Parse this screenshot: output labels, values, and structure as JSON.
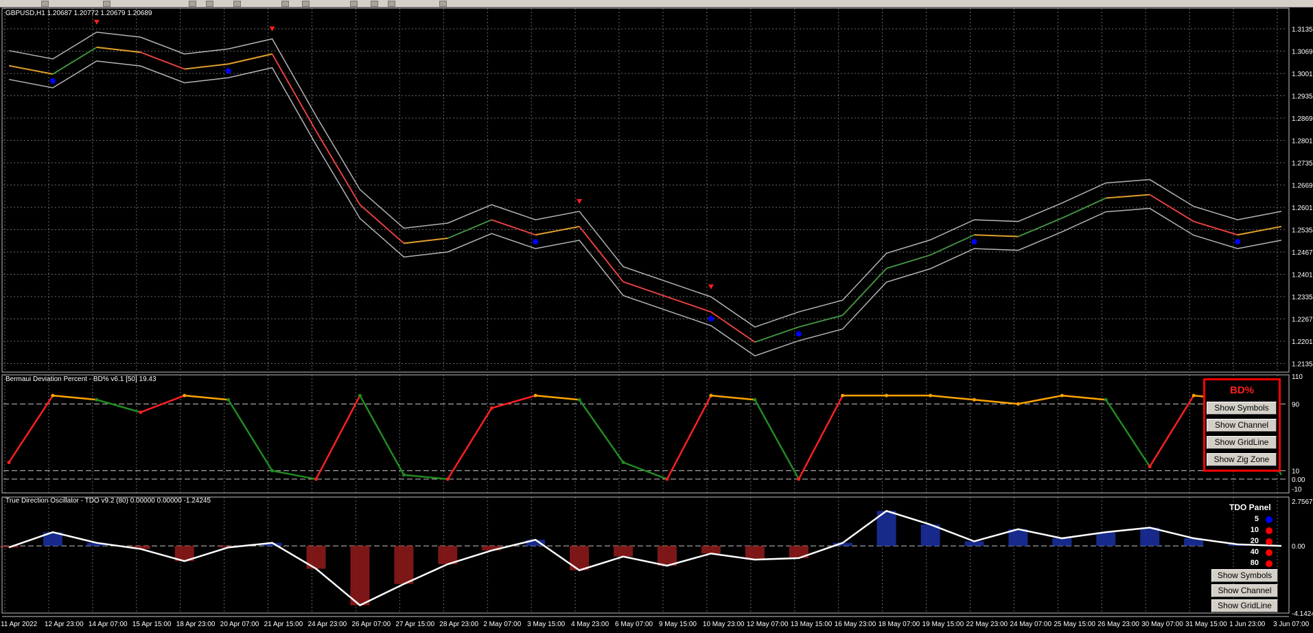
{
  "main_chart": {
    "title": "GBPUSD,H1  1.20687 1.20772 1.20679 1.20689",
    "price_ticks": [
      "1.31350",
      "1.30690",
      "1.30010",
      "1.29350",
      "1.28690",
      "1.28010",
      "1.27350",
      "1.26690",
      "1.26010",
      "1.25350",
      "1.24670",
      "1.24010",
      "1.23350",
      "1.22670",
      "1.22010",
      "1.21350"
    ]
  },
  "bd_indicator": {
    "title": "Bermaui Deviation Percent - BD% v6.1 [50] 19.43",
    "ticks": [
      "110",
      "90",
      "10",
      "0.00",
      "-10"
    ]
  },
  "tdo_indicator": {
    "title": "True Direction Oscillator - TDO v9.2 (80) 0.00000 0.00000 -1.24245",
    "ticks": [
      "2.75679",
      "0.00",
      "-4.14245"
    ]
  },
  "time_axis": [
    "11 Apr 2022",
    "12 Apr 23:00",
    "14 Apr 07:00",
    "15 Apr 15:00",
    "18 Apr 23:00",
    "20 Apr 07:00",
    "21 Apr 15:00",
    "24 Apr 23:00",
    "26 Apr 07:00",
    "27 Apr 15:00",
    "28 Apr 23:00",
    "2 May 07:00",
    "3 May 15:00",
    "4 May 23:00",
    "6 May 07:00",
    "9 May 15:00",
    "10 May 23:00",
    "12 May 07:00",
    "13 May 15:00",
    "16 May 23:00",
    "18 May 07:00",
    "19 May 15:00",
    "22 May 23:00",
    "24 May 07:00",
    "25 May 15:00",
    "26 May 23:00",
    "30 May 07:00",
    "31 May 15:00",
    "1 Jun 23:00",
    "3 Jun 07:00"
  ],
  "bd_panel": {
    "title": "BD%",
    "buttons": [
      "Show Symbols",
      "Show Channel",
      "Show GridLine",
      "Show Zig Zone"
    ]
  },
  "tdo_panel": {
    "title": "TDO Panel",
    "rows": [
      {
        "label": "5",
        "color": "#0000ff"
      },
      {
        "label": "10",
        "color": "#ff0000"
      },
      {
        "label": "20",
        "color": "#ff0000"
      },
      {
        "label": "40",
        "color": "#ff0000"
      },
      {
        "label": "80",
        "color": "#ff0000"
      }
    ],
    "buttons": [
      "Show Symbols",
      "Show Channel",
      "Show GridLine"
    ]
  },
  "chart_data": {
    "type": "line",
    "x": [
      "11 Apr 2022",
      "12 Apr 23:00",
      "14 Apr 07:00",
      "15 Apr 15:00",
      "18 Apr 23:00",
      "20 Apr 07:00",
      "21 Apr 15:00",
      "24 Apr 23:00",
      "26 Apr 07:00",
      "27 Apr 15:00",
      "28 Apr 23:00",
      "2 May 07:00",
      "3 May 15:00",
      "4 May 23:00",
      "6 May 07:00",
      "9 May 15:00",
      "10 May 23:00",
      "12 May 07:00",
      "13 May 15:00",
      "16 May 23:00",
      "18 May 07:00",
      "19 May 15:00",
      "22 May 23:00",
      "24 May 07:00",
      "25 May 15:00",
      "26 May 23:00",
      "30 May 07:00",
      "31 May 15:00",
      "1 Jun 23:00",
      "3 Jun 07:00"
    ],
    "series": [
      {
        "name": "GBPUSD,H1",
        "values": [
          1.3025,
          1.3,
          1.308,
          1.3065,
          1.3015,
          1.303,
          1.306,
          1.283,
          1.261,
          1.2495,
          1.251,
          1.2565,
          1.252,
          1.2545,
          1.238,
          1.2335,
          1.229,
          1.22,
          1.2245,
          1.228,
          1.242,
          1.246,
          1.252,
          1.2515,
          1.257,
          1.263,
          1.264,
          1.256,
          1.252,
          1.2545
        ]
      }
    ],
    "ylim": [
      1.2135,
      1.3135
    ],
    "indicators": {
      "bd_percent": {
        "ylim": [
          -10,
          110
        ],
        "levels": [
          90,
          10,
          0
        ],
        "values": [
          20,
          100,
          95,
          80,
          100,
          95,
          10,
          0,
          100,
          5,
          0,
          85,
          100,
          95,
          20,
          0,
          100,
          95,
          0,
          100,
          100,
          100,
          95,
          90,
          100,
          95,
          15,
          100,
          95,
          5
        ]
      },
      "tdo": {
        "ylim": [
          -4.14245,
          2.75679
        ],
        "values": [
          -0.1,
          0.9,
          0.2,
          -0.2,
          -1.0,
          -0.1,
          0.2,
          -1.5,
          -3.9,
          -2.5,
          -1.2,
          -0.3,
          0.4,
          -1.6,
          -0.7,
          -1.3,
          -0.5,
          -0.9,
          -0.8,
          0.2,
          2.3,
          1.4,
          0.3,
          1.1,
          0.5,
          0.9,
          1.2,
          0.5,
          0.1,
          0.0
        ]
      }
    }
  }
}
